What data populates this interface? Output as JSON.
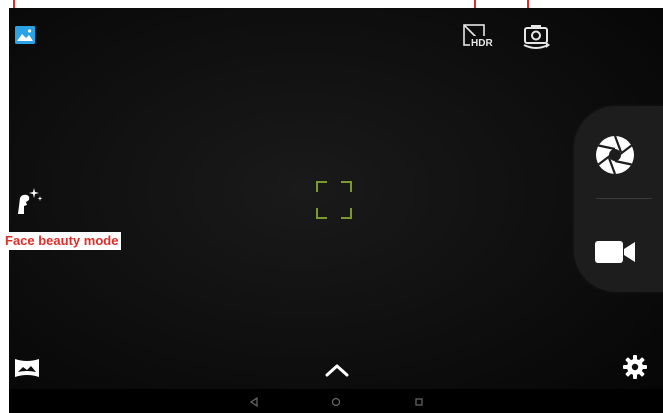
{
  "annotations": {
    "face_beauty_label": "Face beauty mode",
    "callout_color": "#d9302b"
  },
  "toolbar": {
    "top": {
      "gallery": {
        "icon": "gallery-thumbnail-icon",
        "color": "#29a3e6"
      },
      "hdr": {
        "icon": "hdr-off-icon"
      },
      "switch_camera": {
        "icon": "switch-camera-icon"
      }
    },
    "left": {
      "face_beauty": {
        "icon": "face-beauty-icon"
      },
      "panorama": {
        "icon": "panorama-icon"
      }
    },
    "bottom": {
      "expand": {
        "icon": "chevron-up-icon"
      },
      "settings": {
        "icon": "gear-icon"
      }
    }
  },
  "capture_panel": {
    "photo": {
      "icon": "shutter-aperture-icon"
    },
    "video": {
      "icon": "video-camera-icon"
    }
  },
  "viewfinder": {
    "focus_frame_color": "#7a9a2e"
  },
  "system_nav": {
    "back": {
      "icon": "nav-back-icon"
    },
    "home": {
      "icon": "nav-home-icon"
    },
    "recents": {
      "icon": "nav-recents-icon"
    }
  }
}
